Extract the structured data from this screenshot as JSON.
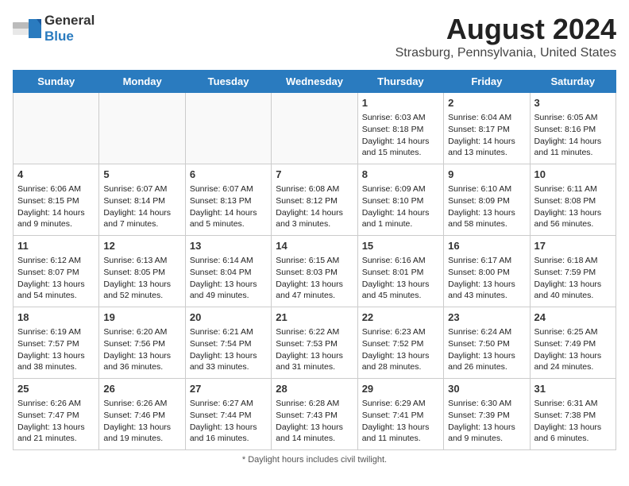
{
  "header": {
    "logo_general": "General",
    "logo_blue": "Blue",
    "month_year": "August 2024",
    "location": "Strasburg, Pennsylvania, United States"
  },
  "days_of_week": [
    "Sunday",
    "Monday",
    "Tuesday",
    "Wednesday",
    "Thursday",
    "Friday",
    "Saturday"
  ],
  "weeks": [
    [
      {
        "day": "",
        "info": ""
      },
      {
        "day": "",
        "info": ""
      },
      {
        "day": "",
        "info": ""
      },
      {
        "day": "",
        "info": ""
      },
      {
        "day": "1",
        "info": "Sunrise: 6:03 AM\nSunset: 8:18 PM\nDaylight: 14 hours and 15 minutes."
      },
      {
        "day": "2",
        "info": "Sunrise: 6:04 AM\nSunset: 8:17 PM\nDaylight: 14 hours and 13 minutes."
      },
      {
        "day": "3",
        "info": "Sunrise: 6:05 AM\nSunset: 8:16 PM\nDaylight: 14 hours and 11 minutes."
      }
    ],
    [
      {
        "day": "4",
        "info": "Sunrise: 6:06 AM\nSunset: 8:15 PM\nDaylight: 14 hours and 9 minutes."
      },
      {
        "day": "5",
        "info": "Sunrise: 6:07 AM\nSunset: 8:14 PM\nDaylight: 14 hours and 7 minutes."
      },
      {
        "day": "6",
        "info": "Sunrise: 6:07 AM\nSunset: 8:13 PM\nDaylight: 14 hours and 5 minutes."
      },
      {
        "day": "7",
        "info": "Sunrise: 6:08 AM\nSunset: 8:12 PM\nDaylight: 14 hours and 3 minutes."
      },
      {
        "day": "8",
        "info": "Sunrise: 6:09 AM\nSunset: 8:10 PM\nDaylight: 14 hours and 1 minute."
      },
      {
        "day": "9",
        "info": "Sunrise: 6:10 AM\nSunset: 8:09 PM\nDaylight: 13 hours and 58 minutes."
      },
      {
        "day": "10",
        "info": "Sunrise: 6:11 AM\nSunset: 8:08 PM\nDaylight: 13 hours and 56 minutes."
      }
    ],
    [
      {
        "day": "11",
        "info": "Sunrise: 6:12 AM\nSunset: 8:07 PM\nDaylight: 13 hours and 54 minutes."
      },
      {
        "day": "12",
        "info": "Sunrise: 6:13 AM\nSunset: 8:05 PM\nDaylight: 13 hours and 52 minutes."
      },
      {
        "day": "13",
        "info": "Sunrise: 6:14 AM\nSunset: 8:04 PM\nDaylight: 13 hours and 49 minutes."
      },
      {
        "day": "14",
        "info": "Sunrise: 6:15 AM\nSunset: 8:03 PM\nDaylight: 13 hours and 47 minutes."
      },
      {
        "day": "15",
        "info": "Sunrise: 6:16 AM\nSunset: 8:01 PM\nDaylight: 13 hours and 45 minutes."
      },
      {
        "day": "16",
        "info": "Sunrise: 6:17 AM\nSunset: 8:00 PM\nDaylight: 13 hours and 43 minutes."
      },
      {
        "day": "17",
        "info": "Sunrise: 6:18 AM\nSunset: 7:59 PM\nDaylight: 13 hours and 40 minutes."
      }
    ],
    [
      {
        "day": "18",
        "info": "Sunrise: 6:19 AM\nSunset: 7:57 PM\nDaylight: 13 hours and 38 minutes."
      },
      {
        "day": "19",
        "info": "Sunrise: 6:20 AM\nSunset: 7:56 PM\nDaylight: 13 hours and 36 minutes."
      },
      {
        "day": "20",
        "info": "Sunrise: 6:21 AM\nSunset: 7:54 PM\nDaylight: 13 hours and 33 minutes."
      },
      {
        "day": "21",
        "info": "Sunrise: 6:22 AM\nSunset: 7:53 PM\nDaylight: 13 hours and 31 minutes."
      },
      {
        "day": "22",
        "info": "Sunrise: 6:23 AM\nSunset: 7:52 PM\nDaylight: 13 hours and 28 minutes."
      },
      {
        "day": "23",
        "info": "Sunrise: 6:24 AM\nSunset: 7:50 PM\nDaylight: 13 hours and 26 minutes."
      },
      {
        "day": "24",
        "info": "Sunrise: 6:25 AM\nSunset: 7:49 PM\nDaylight: 13 hours and 24 minutes."
      }
    ],
    [
      {
        "day": "25",
        "info": "Sunrise: 6:26 AM\nSunset: 7:47 PM\nDaylight: 13 hours and 21 minutes."
      },
      {
        "day": "26",
        "info": "Sunrise: 6:26 AM\nSunset: 7:46 PM\nDaylight: 13 hours and 19 minutes."
      },
      {
        "day": "27",
        "info": "Sunrise: 6:27 AM\nSunset: 7:44 PM\nDaylight: 13 hours and 16 minutes."
      },
      {
        "day": "28",
        "info": "Sunrise: 6:28 AM\nSunset: 7:43 PM\nDaylight: 13 hours and 14 minutes."
      },
      {
        "day": "29",
        "info": "Sunrise: 6:29 AM\nSunset: 7:41 PM\nDaylight: 13 hours and 11 minutes."
      },
      {
        "day": "30",
        "info": "Sunrise: 6:30 AM\nSunset: 7:39 PM\nDaylight: 13 hours and 9 minutes."
      },
      {
        "day": "31",
        "info": "Sunrise: 6:31 AM\nSunset: 7:38 PM\nDaylight: 13 hours and 6 minutes."
      }
    ]
  ],
  "footer": {
    "daylight_note": "Daylight hours"
  }
}
